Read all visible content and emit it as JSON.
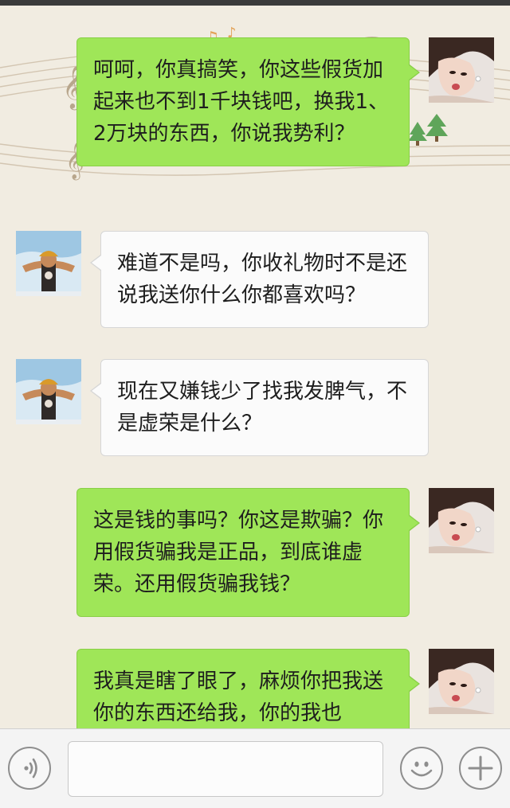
{
  "messages": [
    {
      "direction": "sent",
      "text": "呵呵，你真搞笑，你这些假货加起来也不到1千块钱吧，换我1、2万块的东西，你说我势利？"
    },
    {
      "direction": "received",
      "text": "难道不是吗，你收礼物时不是还说我送你什么你都喜欢吗？"
    },
    {
      "direction": "received",
      "text": "现在又嫌钱少了找我发脾气，不是虚荣是什么？"
    },
    {
      "direction": "sent",
      "text": "这是钱的事吗？你这是欺骗？你用假货骗我是正品，到底谁虚荣。还用假货骗我钱？"
    },
    {
      "direction": "sent",
      "text": "我真是瞎了眼了，麻烦你把我送你的东西还给我，你的我也"
    }
  ],
  "input_bar": {
    "voice_icon": "voice-icon",
    "emoji_icon": "emoji-icon",
    "plus_icon": "plus-icon",
    "message_value": ""
  },
  "colors": {
    "sent_bubble": "#9fe658",
    "received_bubble": "#fbfbfb",
    "background": "#f1ece1"
  }
}
